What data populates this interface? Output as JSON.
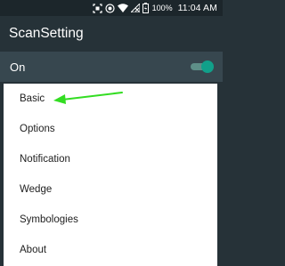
{
  "status_bar": {
    "battery_percent": "100%",
    "time": "11:04 AM",
    "icons": [
      "scan-icon",
      "target-icon",
      "wifi-icon",
      "no-sim-icon",
      "battery-icon"
    ]
  },
  "app_bar": {
    "title": "ScanSetting"
  },
  "master_switch": {
    "label": "On",
    "state": true,
    "accent_color": "#11a08a"
  },
  "menu": {
    "items": [
      {
        "label": "Basic"
      },
      {
        "label": "Options"
      },
      {
        "label": "Notification"
      },
      {
        "label": "Wedge"
      },
      {
        "label": "Symbologies"
      },
      {
        "label": "About"
      }
    ]
  },
  "annotation": {
    "color": "#33dd22",
    "points_to": "Basic"
  }
}
